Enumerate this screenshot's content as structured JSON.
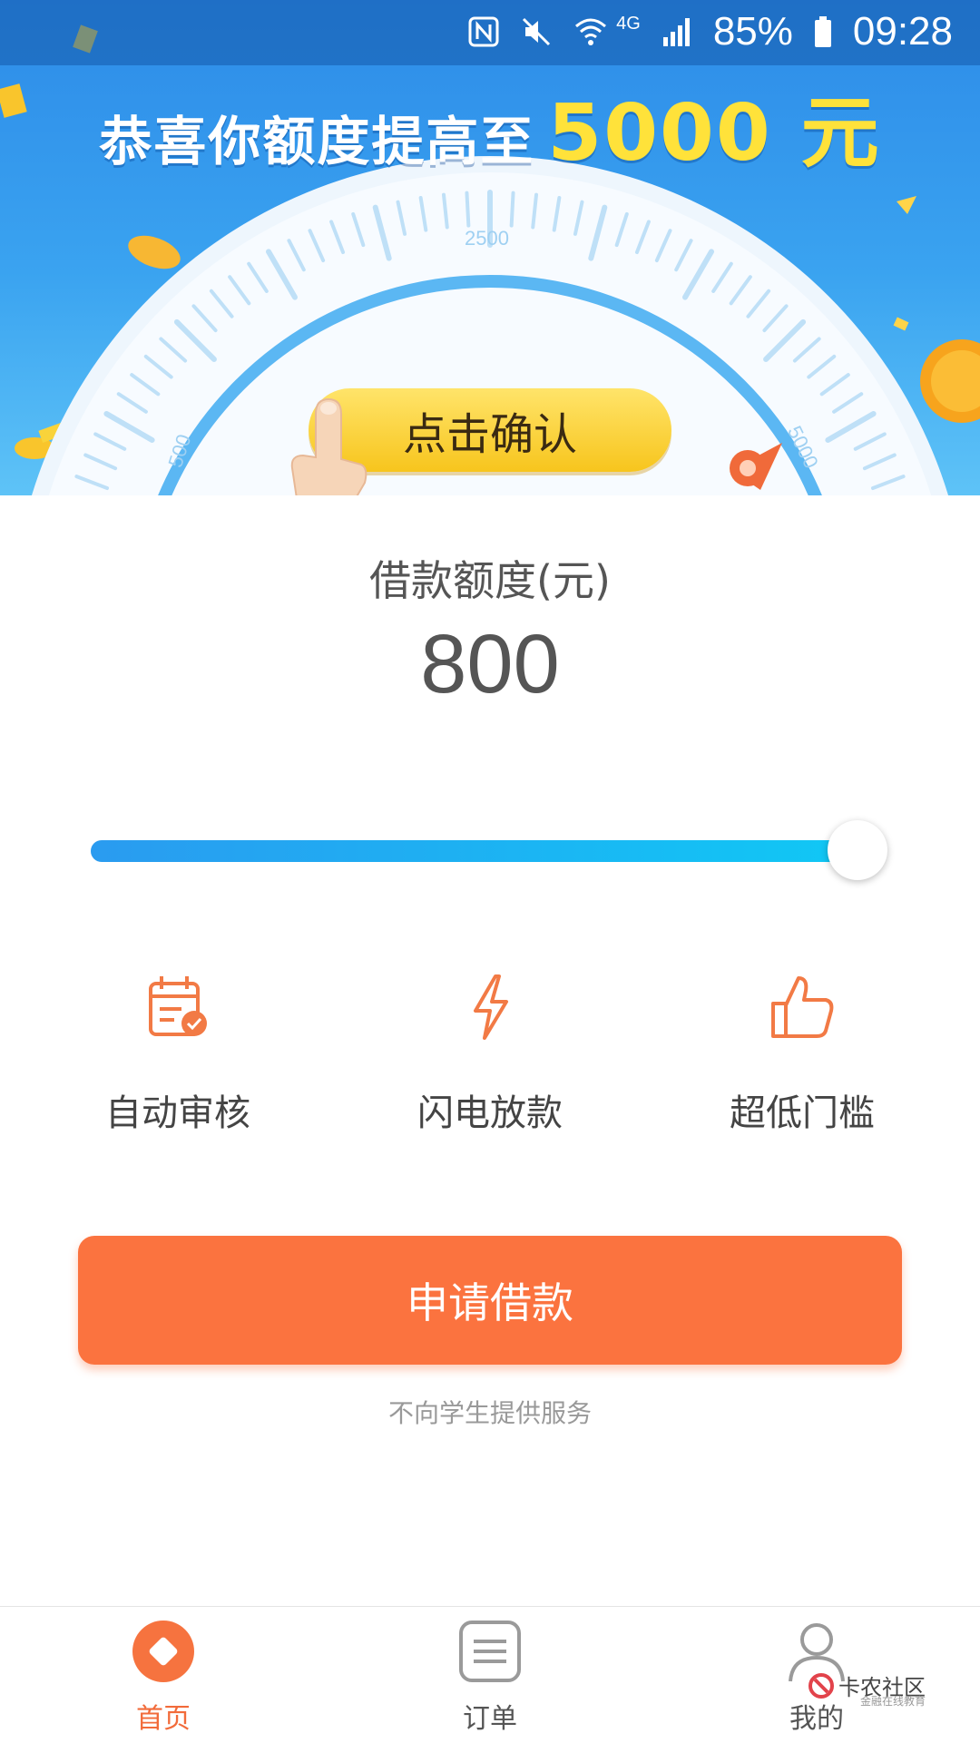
{
  "status_bar": {
    "network": "4G",
    "battery_percent": "85%",
    "time": "09:28"
  },
  "banner": {
    "headline": "恭喜你额度提高至",
    "headline_amount": "5000 元",
    "gauge": {
      "tick_500": "500",
      "tick_2500": "2500",
      "tick_5000": "5000"
    },
    "confirm_button": "点击确认"
  },
  "loan": {
    "label": "借款额度(元)",
    "amount": "800",
    "slider_fraction": 1.0
  },
  "features": [
    {
      "label": "自动审核",
      "icon": "calendar-check-icon"
    },
    {
      "label": "闪电放款",
      "icon": "lightning-icon"
    },
    {
      "label": "超低门槛",
      "icon": "thumbs-up-icon"
    }
  ],
  "apply_button": "申请借款",
  "note": "不向学生提供服务",
  "nav": {
    "home": "首页",
    "orders": "订单",
    "mine": "我的"
  },
  "watermark": {
    "title": "卡农社区",
    "subtitle": "金融在线教育"
  },
  "colors": {
    "accent": "#fb733f",
    "banner_blue": "#2d8be8",
    "slider_blue": "#10c8f5",
    "headline_yellow": "#ffe23a"
  }
}
